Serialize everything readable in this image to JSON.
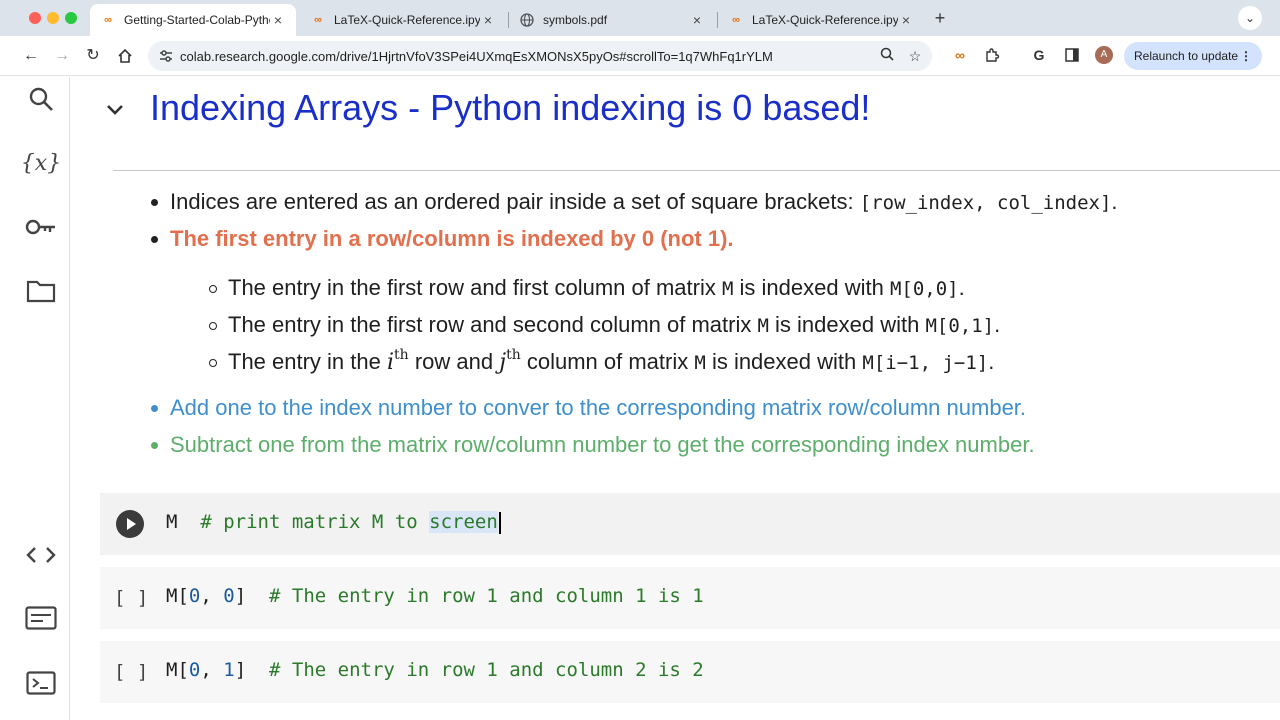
{
  "browser": {
    "tabs": [
      {
        "title": "Getting-Started-Colab-Pytho",
        "favicon": "colab-icon"
      },
      {
        "title": "LaTeX-Quick-Reference.ipynb",
        "favicon": "colab-icon"
      },
      {
        "title": "symbols.pdf",
        "favicon": "globe-icon"
      },
      {
        "title": "LaTeX-Quick-Reference.ipynb",
        "favicon": "colab-icon"
      }
    ],
    "url": "colab.research.google.com/drive/1HjrtnVfoV3SPei4UXmqEsXMONsX5pyOs#scrollTo=1q7WhFq1rYLM",
    "avatar_letter": "A",
    "relaunch_label": "Relaunch to update"
  },
  "rail": {
    "items": [
      "search-icon",
      "variables-icon",
      "key-icon",
      "folder-icon",
      "code-snippets-icon",
      "command-palette-icon",
      "terminal-icon"
    ],
    "variables_label": "{x}"
  },
  "notebook": {
    "heading": "Indexing Arrays - Python indexing is 0 based!",
    "bullet1": {
      "text": "Indices are entered as an ordered pair inside a set of square brackets:",
      "code": "[row_index, col_index]",
      "end": "."
    },
    "bullet2": "The first entry in a row/column is indexed by 0 (not 1).",
    "sub1": {
      "pre": "The entry in the first row and first column of matrix",
      "var": "M",
      "mid": "is indexed with",
      "code": "M[0,0]",
      "end": "."
    },
    "sub2": {
      "pre": "The entry in the first row and second column of matrix",
      "var": "M",
      "mid": "is indexed with",
      "code": "M[0,1]",
      "end": "."
    },
    "sub3": {
      "pre": "The entry in the",
      "i": "i",
      "th1": "th",
      "row_and": "row and",
      "j": "j",
      "th2": "th",
      "col": "column of matrix",
      "var": "M",
      "mid": "is indexed with",
      "code": "M[i−1, j−1]",
      "end": "."
    },
    "bullet3": "Add one to the index number to conver to the corresponding matrix row/column number.",
    "bullet4": "Subtract one from the matrix row/column number to get the corresponding index number."
  },
  "cells": [
    {
      "bracket": "",
      "var": "M",
      "comment_pre": "# print matrix M to ",
      "comment_sel": "screen"
    },
    {
      "bracket": "[ ]",
      "var": "M",
      "lb": "[",
      "n1": "0",
      "sep": ", ",
      "n2": "0",
      "rb": "]",
      "comment": "# The entry in row 1 and column 1 is 1"
    },
    {
      "bracket": "[ ]",
      "var": "M",
      "lb": "[",
      "n1": "0",
      "sep": ", ",
      "n2": "1",
      "rb": "]",
      "comment": "# The entry in row 1 and column 2 is 2"
    }
  ],
  "colors": {
    "heading": "#1a2fc9",
    "red_bullet": "#e2704e",
    "blue_bullet": "#3f8fcd",
    "green_bullet": "#5cae6a"
  }
}
